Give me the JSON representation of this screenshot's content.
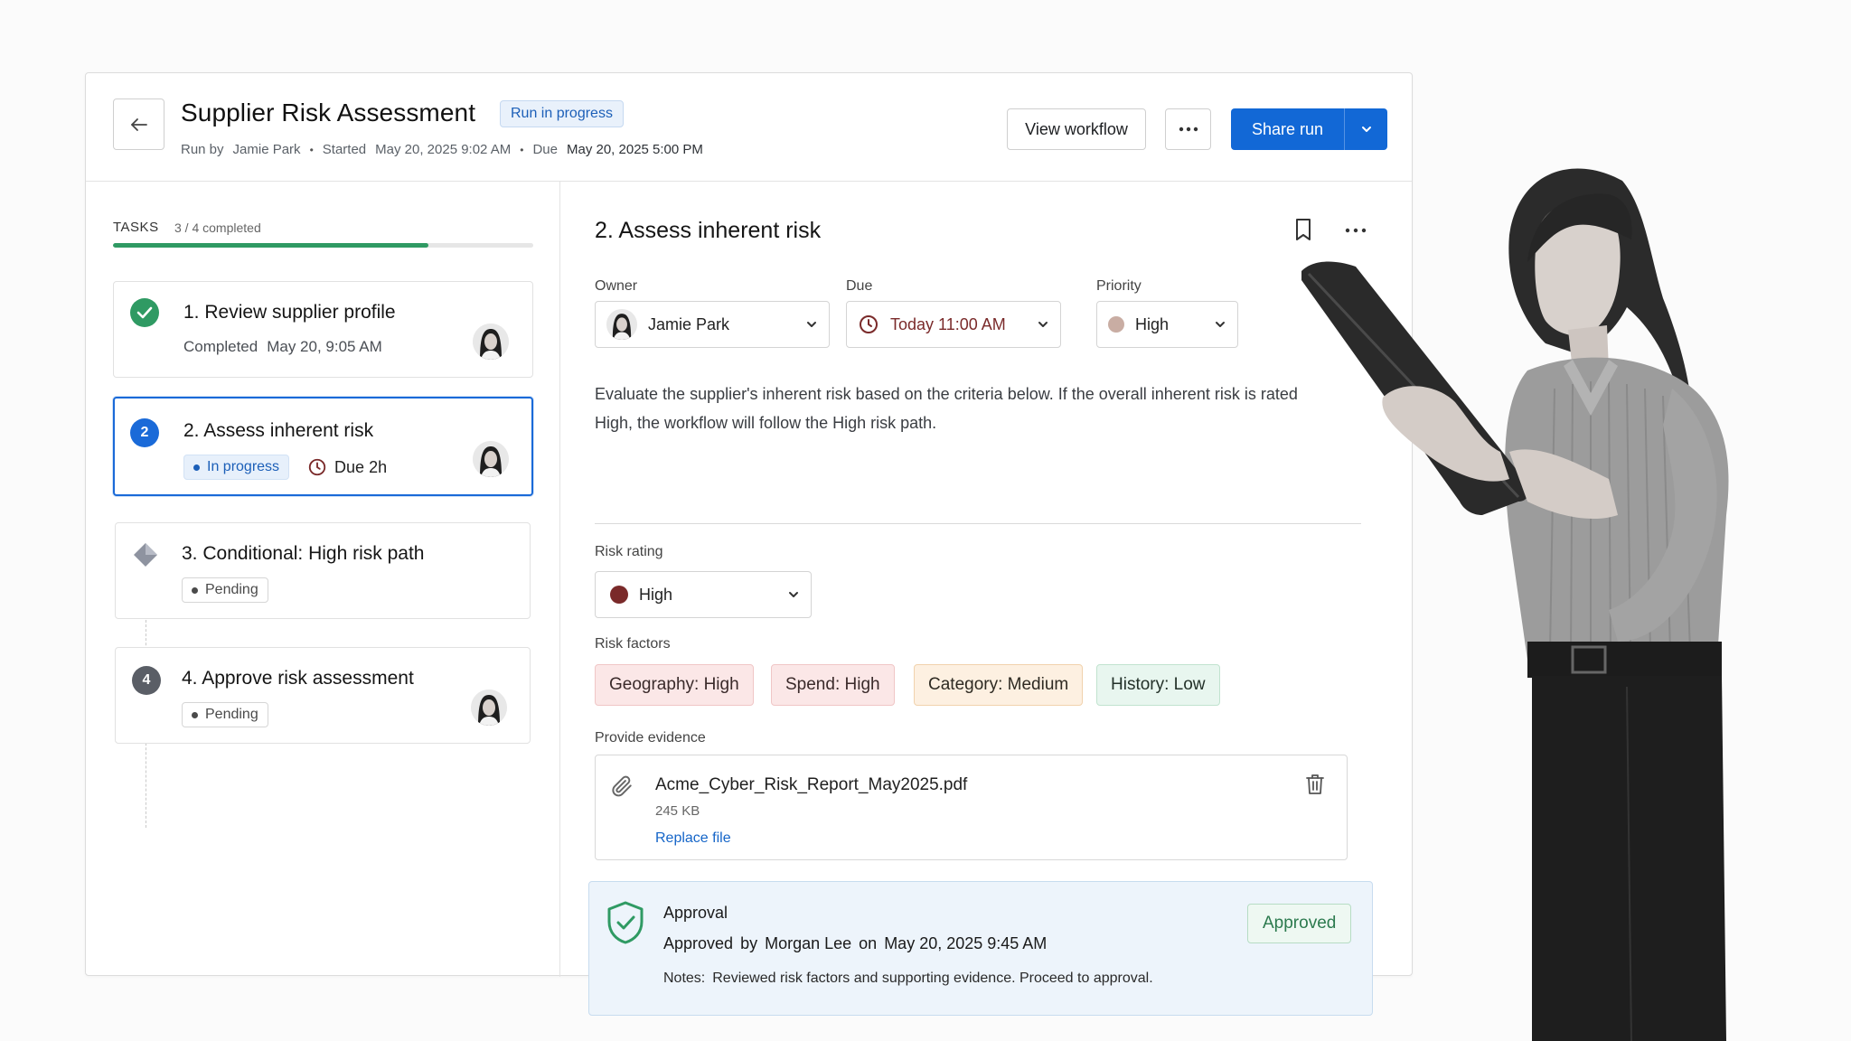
{
  "header": {
    "title": "Supplier Risk Assessment",
    "status_badge": "Run in progress",
    "run_by_label": "Run by",
    "run_by": "Jamie Park",
    "started_label": "Started",
    "started": "May 20, 2025 9:02 AM",
    "due_label": "Due",
    "due": "May 20, 2025 5:00 PM",
    "view_workflow": "View workflow",
    "share_run": "Share run"
  },
  "tasks": {
    "label": "TASKS",
    "count": "3 / 4 completed",
    "progress": 0.75,
    "items": [
      {
        "number": "1",
        "title": "1. Review supplier profile",
        "sub_label": "Completed",
        "sub_value": "May 20, 9:05 AM"
      },
      {
        "number": "2",
        "title": "2. Assess inherent risk",
        "status": "In progress",
        "due": "Due 2h"
      },
      {
        "number": "3",
        "title": "3. Conditional: High risk path",
        "status": "Pending"
      },
      {
        "number": "4",
        "title": "4. Approve risk assessment",
        "status": "Pending"
      }
    ]
  },
  "detail": {
    "title": "2. Assess inherent risk",
    "owner_label": "Owner",
    "owner": "Jamie Park",
    "due_label": "Due",
    "due": "Today 11:00 AM",
    "priority_label": "Priority",
    "priority": "High",
    "description": "Evaluate the supplier's inherent risk based on the criteria below. If the overall inherent risk is rated High, the workflow will follow the High risk path.",
    "risk_rating_label": "Risk rating",
    "risk_rating": "High",
    "risk_factors_label": "Risk factors",
    "risk_factors": [
      "Geography: High",
      "Spend: High",
      "Category: Medium",
      "History: Low"
    ],
    "evidence_label": "Provide evidence",
    "file_name": "Acme_Cyber_Risk_Report_May2025.pdf",
    "file_size": "245 KB",
    "replace_file": "Replace file"
  },
  "approval": {
    "title": "Approval",
    "status": "Approved",
    "by_label": "by",
    "by": "Morgan Lee",
    "on_label": "on",
    "on": "May 20, 2025 9:45 AM",
    "notes_label": "Notes:",
    "notes": "Reviewed risk factors and supporting evidence. Proceed to approval.",
    "badge": "Approved"
  },
  "colors": {
    "primary": "#1268d6",
    "success": "#2f9a63",
    "risk_high": "#7a2a2a"
  }
}
